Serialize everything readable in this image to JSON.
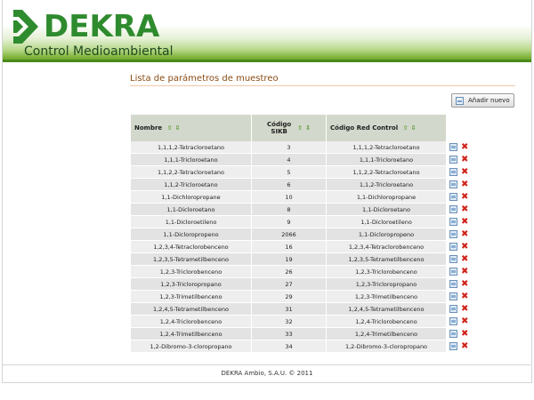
{
  "header": {
    "brand": "DEKRA",
    "subtitle": "Control Medioambiental"
  },
  "page": {
    "title": "Lista de parámetros de muestreo",
    "add_button_label": "Añadir nuevo"
  },
  "table": {
    "columns": [
      {
        "line1": "Nombre",
        "line2": ""
      },
      {
        "line1": "Código",
        "line2": "SIKB"
      },
      {
        "line1": "Código Red Control",
        "line2": ""
      }
    ],
    "rows": [
      {
        "nombre": "1,1,1,2-Tetracloroetano",
        "sikb": "3",
        "red": "1,1,1,2-Tetracloroetano"
      },
      {
        "nombre": "1,1,1-Tricloroetano",
        "sikb": "4",
        "red": "1,1,1-Tricloroetano"
      },
      {
        "nombre": "1,1,2,2-Tetracloroetano",
        "sikb": "5",
        "red": "1,1,2,2-Tetracloroetano"
      },
      {
        "nombre": "1,1,2-Tricloroetano",
        "sikb": "6",
        "red": "1,1,2-Tricloroetano"
      },
      {
        "nombre": "1,1-Dichloropropane",
        "sikb": "10",
        "red": "1,1-Dichloropropane"
      },
      {
        "nombre": "1,1-Dicloroetano",
        "sikb": "8",
        "red": "1,1-Dicloroetano"
      },
      {
        "nombre": "1,1-Dicloroetileno",
        "sikb": "9",
        "red": "1,1-Dicloroetileno"
      },
      {
        "nombre": "1,1-Dicloropropeno",
        "sikb": "2066",
        "red": "1,1-Dicloropropeno"
      },
      {
        "nombre": "1,2,3,4-Tetraclorobenceno",
        "sikb": "16",
        "red": "1,2,3,4-Tetraclorobenceno"
      },
      {
        "nombre": "1,2,3,5-Tetrametilbenceno",
        "sikb": "19",
        "red": "1,2,3,5-Tetrametilbenceno"
      },
      {
        "nombre": "1,2,3-Triclorobenceno",
        "sikb": "26",
        "red": "1,2,3-Triclorobenceno"
      },
      {
        "nombre": "1,2,3-Tricloropropano",
        "sikb": "27",
        "red": "1,2,3-Tricloropropano"
      },
      {
        "nombre": "1,2,3-Trimetilbenceno",
        "sikb": "29",
        "red": "1,2,3-Trimetilbenceno"
      },
      {
        "nombre": "1,2,4,5-Tetrametilbenceno",
        "sikb": "31",
        "red": "1,2,4,5-Tetrametilbenceno"
      },
      {
        "nombre": "1,2,4-Triclorobenceno",
        "sikb": "32",
        "red": "1,2,4-Triclorobenceno"
      },
      {
        "nombre": "1,2,4-Trimetilbenceno",
        "sikb": "33",
        "red": "1,2,4-Trimetilbenceno"
      },
      {
        "nombre": "1,2-Dibromo-3-cloropropano",
        "sikb": "34",
        "red": "1,2-Dibromo-3-cloropropano"
      }
    ]
  },
  "footer": {
    "text": "DEKRA Ambio, S.A.U. © 2011"
  },
  "colors": {
    "brand_green": "#2e8b2e",
    "title_brown": "#8a4c14",
    "delete_red": "#d0231a"
  }
}
